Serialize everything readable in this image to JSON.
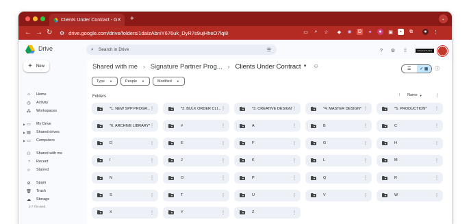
{
  "browser": {
    "tab_title": "Clients Under Contract - Goo",
    "url": "drive.google.com/drive/folders/1daIzAbniY676uk_DyR7s9ujHheO7lqi8"
  },
  "header": {
    "app_name": "Drive",
    "search_placeholder": "Search in Drive",
    "badge_text": "SIGNATURE"
  },
  "sidebar": {
    "new_label": "New",
    "items": [
      {
        "label": "Home",
        "icon": "home-icon",
        "glyph": "⌂"
      },
      {
        "label": "Activity",
        "icon": "activity-icon",
        "glyph": "◷"
      },
      {
        "label": "Workspaces",
        "icon": "workspaces-icon",
        "glyph": "⁂"
      },
      {
        "label": "My Drive",
        "icon": "my-drive-icon",
        "glyph": "▭"
      },
      {
        "label": "Shared drives",
        "icon": "shared-drives-icon",
        "glyph": "▤"
      },
      {
        "label": "Computers",
        "icon": "computers-icon",
        "glyph": "▭"
      },
      {
        "label": "Shared with me",
        "icon": "shared-with-me-icon",
        "glyph": "⚇"
      },
      {
        "label": "Recent",
        "icon": "recent-icon",
        "glyph": "◔"
      },
      {
        "label": "Starred",
        "icon": "starred-icon",
        "glyph": "☆"
      },
      {
        "label": "Spam",
        "icon": "spam-icon",
        "glyph": "⊘"
      },
      {
        "label": "Trash",
        "icon": "trash-icon",
        "glyph": "🗑"
      },
      {
        "label": "Storage",
        "icon": "storage-icon",
        "glyph": "☁"
      }
    ],
    "storage_used": "2.7 TB used"
  },
  "breadcrumb": {
    "items": [
      "Shared with me",
      "Signature Partner Prog...",
      "Clients Under Contract"
    ]
  },
  "filters": [
    "Type",
    "People",
    "Modified"
  ],
  "section": {
    "title": "Folders",
    "sort_label": "Name"
  },
  "folders": [
    "*1. NEW SPP PROGR...",
    "*2. BULK ORDER CLI...",
    "*3. CREATIVE DESIGN*",
    "*4. MASTER DESIGN*",
    "*5. PRODUCTION*",
    "*6. ARCHIVE LIBRARY*",
    "#",
    "A",
    "B",
    "C",
    "D",
    "E",
    "F",
    "G",
    "H",
    "I",
    "J",
    "K",
    "L",
    "M",
    "N",
    "O",
    "P",
    "Q",
    "R",
    "S",
    "T",
    "U",
    "V",
    "W",
    "X",
    "Y",
    "Z"
  ],
  "colors": {
    "tabbar": "#8b1a17",
    "addressbar": "#b42b24",
    "folder_bg": "#edf1f7",
    "active_view": "#c2e7ff"
  }
}
